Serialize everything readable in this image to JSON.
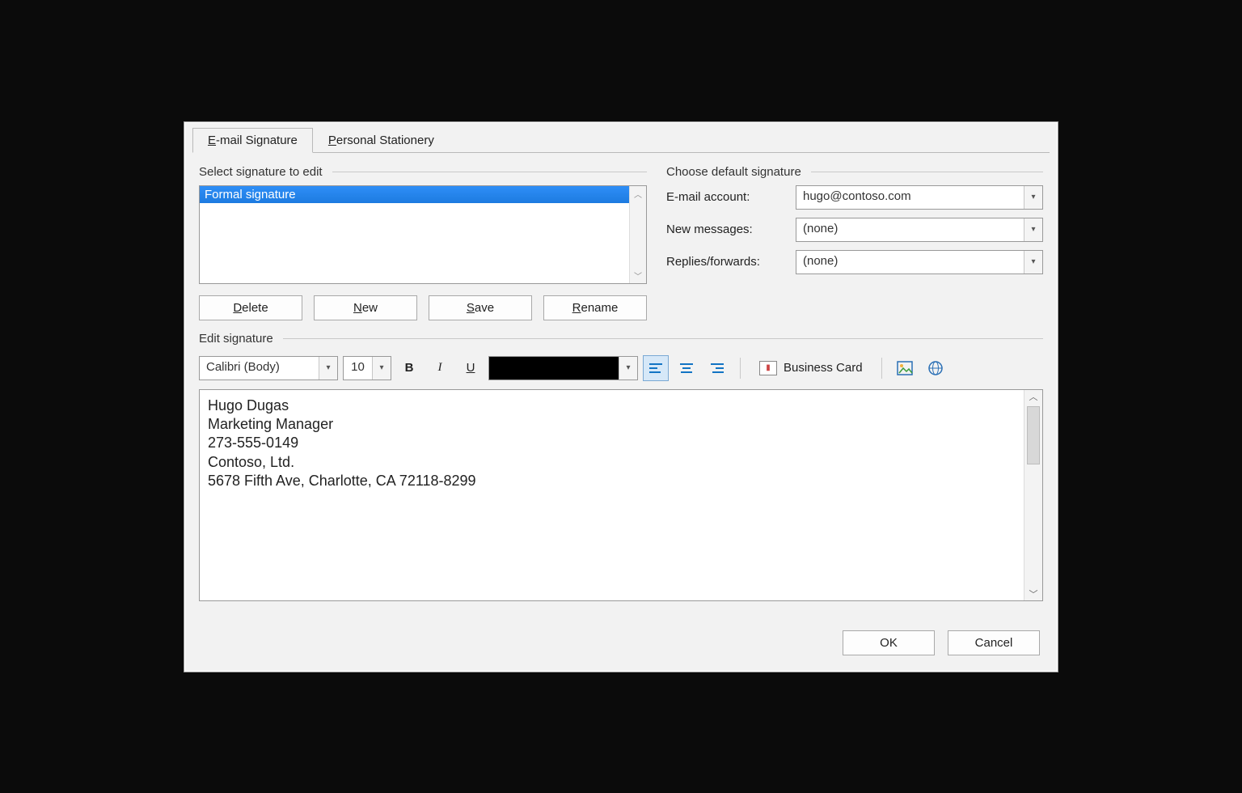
{
  "tabs": {
    "email_signature": "E-mail Signature",
    "personal_stationery": "Personal Stationery"
  },
  "select_group_label": "Select signature to edit",
  "signature_list": {
    "items": [
      "Formal signature"
    ],
    "selected_index": 0
  },
  "list_buttons": {
    "delete": "Delete",
    "new": "New",
    "save": "Save",
    "rename": "Rename"
  },
  "default_group_label": "Choose default signature",
  "fields": {
    "email_account_label": "E-mail account:",
    "email_account_value": "hugo@contoso.com",
    "new_messages_label": "New messages:",
    "new_messages_value": "(none)",
    "replies_forwards_label": "Replies/forwards:",
    "replies_forwards_value": "(none)"
  },
  "edit_group_label": "Edit signature",
  "toolbar": {
    "font": "Calibri (Body)",
    "size": "10",
    "bold": "B",
    "italic": "I",
    "underline": "U",
    "business_card": "Business Card"
  },
  "signature_body": "Hugo Dugas\nMarketing Manager\n273-555-0149\nContoso, Ltd.\n5678 Fifth Ave, Charlotte, CA 72118-8299",
  "footer": {
    "ok": "OK",
    "cancel": "Cancel"
  }
}
